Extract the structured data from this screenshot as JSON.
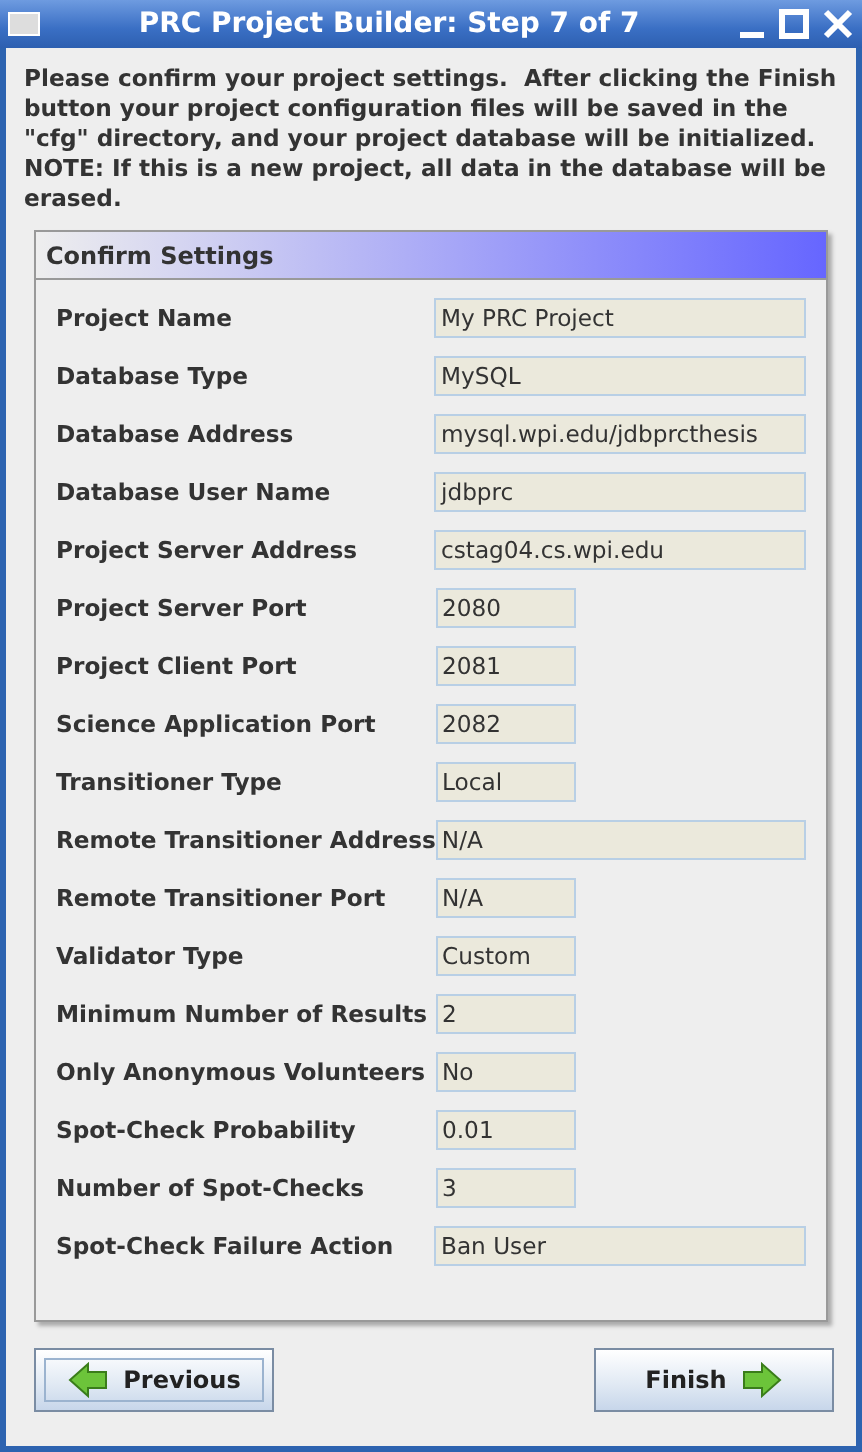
{
  "window": {
    "title": "PRC Project Builder: Step 7 of 7"
  },
  "intro": "Please confirm your project settings.  After clicking the Finish button your project configuration files will be saved in the \"cfg\" directory, and your project database will be initialized. NOTE: If this is a new project, all data in the database will be erased.",
  "panel": {
    "title": "Confirm Settings"
  },
  "settings": [
    {
      "label": "Project Name",
      "value": "My PRC Project",
      "kind": "wide"
    },
    {
      "label": "Database Type",
      "value": "MySQL",
      "kind": "wide"
    },
    {
      "label": "Database Address",
      "value": "mysql.wpi.edu/jdbprcthesis",
      "kind": "wide"
    },
    {
      "label": "Database User Name",
      "value": "jdbprc",
      "kind": "wide"
    },
    {
      "label": "Project Server Address",
      "value": "cstag04.cs.wpi.edu",
      "kind": "wide"
    },
    {
      "label": "Project Server Port",
      "value": "2080",
      "kind": "short"
    },
    {
      "label": "Project Client Port",
      "value": "2081",
      "kind": "short"
    },
    {
      "label": "Science Application Port",
      "value": "2082",
      "kind": "short"
    },
    {
      "label": "Transitioner Type",
      "value": "Local",
      "kind": "short"
    },
    {
      "label": "Remote Transitioner Address",
      "value": "N/A",
      "kind": "wide"
    },
    {
      "label": "Remote Transitioner Port",
      "value": "N/A",
      "kind": "short"
    },
    {
      "label": "Validator Type",
      "value": "Custom",
      "kind": "short"
    },
    {
      "label": "Minimum Number of Results",
      "value": "2",
      "kind": "short"
    },
    {
      "label": "Only Anonymous Volunteers",
      "value": "No",
      "kind": "short"
    },
    {
      "label": "Spot-Check Probability",
      "value": "0.01",
      "kind": "short"
    },
    {
      "label": "Number of Spot-Checks",
      "value": "3",
      "kind": "short"
    },
    {
      "label": "Spot-Check Failure Action",
      "value": "Ban User",
      "kind": "wide"
    }
  ],
  "buttons": [
    {
      "label": "Previous",
      "kind": "back",
      "focused": true
    },
    {
      "label": "Finish",
      "kind": "next",
      "focused": false
    }
  ]
}
